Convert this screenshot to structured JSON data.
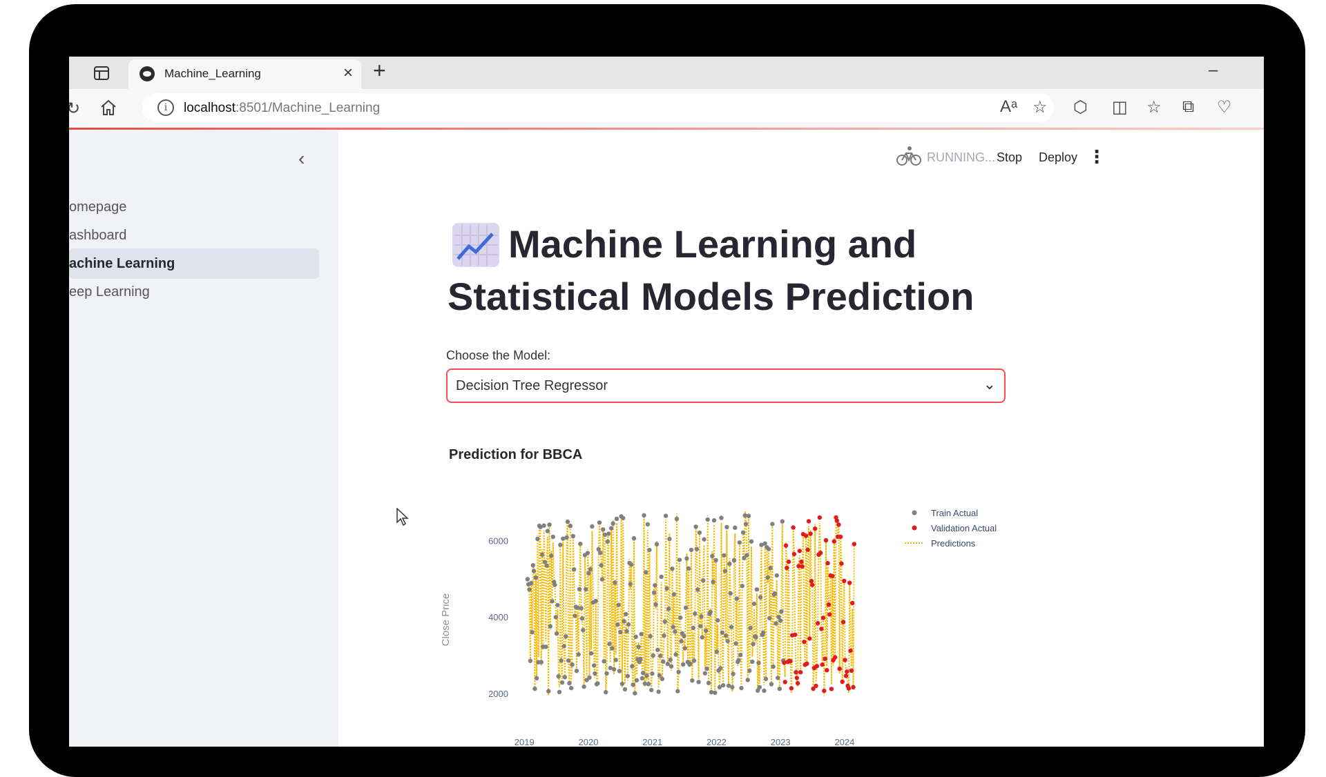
{
  "browser": {
    "tab_title": "Machine_Learning",
    "url_host": "localhost",
    "url_rest": ":8501/Machine_Learning"
  },
  "sidebar": {
    "items": [
      {
        "label": "omepage",
        "active": false
      },
      {
        "label": "ashboard",
        "active": false
      },
      {
        "label": "achine Learning",
        "active": true
      },
      {
        "label": "eep Learning",
        "active": false
      }
    ]
  },
  "header": {
    "status": "RUNNING...",
    "stop_label": "Stop",
    "deploy_label": "Deploy"
  },
  "main": {
    "title": "Machine Learning and Statistical Models Prediction",
    "select_label": "Choose the Model:",
    "select_value": "Decision Tree Regressor",
    "chart_title": "Prediction for BBCA"
  },
  "chart_data": {
    "type": "scatter",
    "title": "Prediction for BBCA",
    "xlabel": "",
    "ylabel": "Close Price",
    "x_ticks": [
      "2019",
      "2020",
      "2021",
      "2022",
      "2023",
      "2024"
    ],
    "y_ticks": [
      2000,
      4000,
      6000
    ],
    "ylim": [
      1400,
      7000
    ],
    "xlim": [
      2018.9,
      2024.4
    ],
    "series": [
      {
        "name": "Train Actual",
        "color": "#808080",
        "x_range": [
          2019.05,
          2023.05
        ],
        "y_range": [
          1900,
          7000
        ]
      },
      {
        "name": "Validation Actual",
        "color": "#e31a1c",
        "x_range": [
          2023.05,
          2024.15
        ],
        "y_range": [
          2100,
          6900
        ]
      },
      {
        "name": "Predictions",
        "color": "#f5b800",
        "style": "dotted",
        "x_range": [
          2019.05,
          2024.15
        ],
        "y_range": [
          1900,
          7000
        ]
      }
    ],
    "legend": "top-right",
    "grid": false
  }
}
